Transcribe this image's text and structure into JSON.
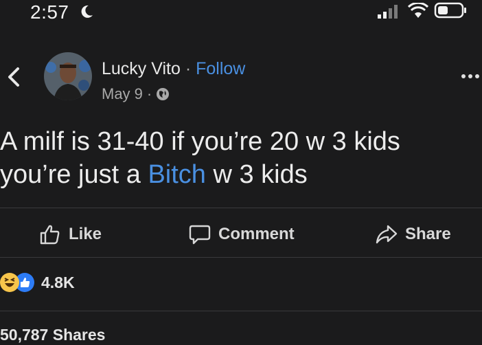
{
  "status_bar": {
    "time": "2:57"
  },
  "post": {
    "author": "Lucky Vito",
    "separator": "·",
    "follow_label": "Follow",
    "date": "May 9",
    "date_separator": "·",
    "text_line1": "A milf is 31-40 if you’re 20 w 3 kids",
    "text_line2_before": "you’re just a ",
    "text_line2_mention": "Bitch",
    "text_line2_after": " w 3 kids"
  },
  "actions": {
    "like_label": "Like",
    "comment_label": "Comment",
    "share_label": "Share"
  },
  "reactions": {
    "count": "4.8K",
    "types": [
      "haha",
      "like"
    ]
  },
  "shares": {
    "label": "50,787 Shares"
  },
  "colors": {
    "background": "#1b1b1c",
    "link": "#4a90e2",
    "divider": "#3a3a3c"
  }
}
